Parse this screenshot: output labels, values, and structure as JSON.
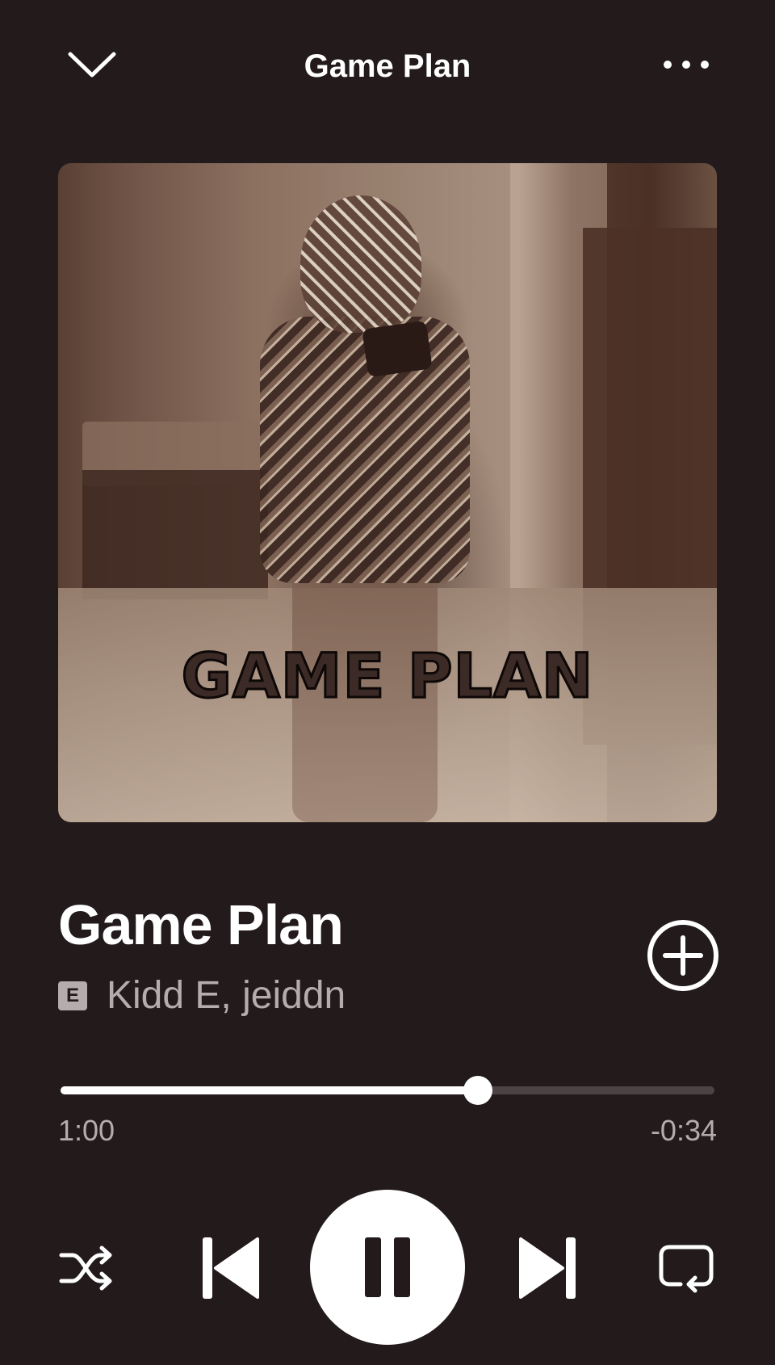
{
  "header": {
    "title": "Game Plan",
    "collapse_icon": "chevron-down-icon",
    "more_icon": "more-options-icon"
  },
  "album_art": {
    "lettering": "GAME PLAN"
  },
  "track": {
    "title": "Game Plan",
    "explicit_badge": "E",
    "artists": "Kidd E, jeiddn"
  },
  "playback": {
    "elapsed": "1:00",
    "remaining": "-0:34",
    "progress_fraction": 0.638,
    "state": "playing"
  },
  "controls": {
    "shuffle_icon": "shuffle-icon",
    "previous_icon": "skip-previous-icon",
    "play_pause_icon": "pause-icon",
    "next_icon": "skip-next-icon",
    "repeat_icon": "repeat-icon",
    "add_icon": "add-circle-icon"
  },
  "colors": {
    "background": "#221a1b",
    "primary_text": "#ffffff",
    "secondary_text": "#b3adae",
    "progress_track": "#4b4344"
  }
}
